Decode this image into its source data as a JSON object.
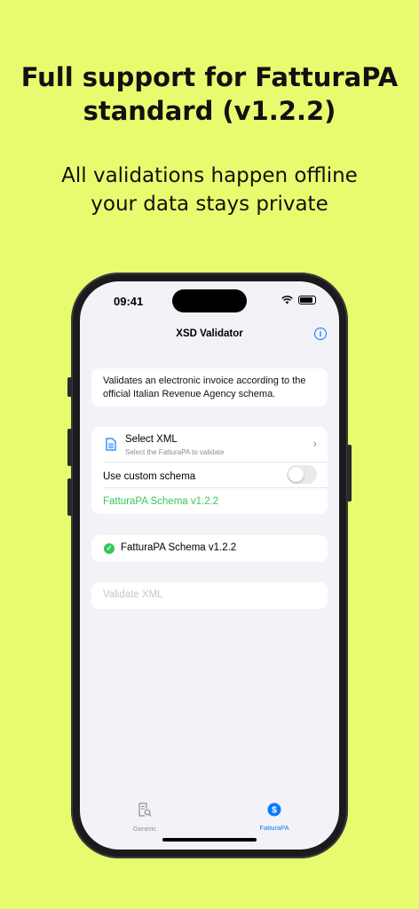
{
  "headline": {
    "line1": "Full support for FatturaPA",
    "line2": "standard (v1.2.2)"
  },
  "subline": {
    "line1": "All validations happen offline",
    "line2": "your data stays private"
  },
  "status_bar": {
    "time": "09:41"
  },
  "nav": {
    "title": "XSD Validator",
    "info_icon": "i"
  },
  "description": "Validates an electronic invoice according to the official Italian Revenue Agency schema.",
  "select_xml": {
    "title": "Select XML",
    "subtitle": "Select the FatturaPA to validate"
  },
  "custom_schema": {
    "label": "Use custom schema",
    "enabled": false
  },
  "schema_link": "FatturaPA Schema v1.2.2",
  "status": {
    "text": "FatturaPA Schema v1.2.2",
    "state": "valid"
  },
  "validate_button": "Validate XML",
  "tabs": [
    {
      "label": "Generic",
      "icon": "doc-search-icon",
      "selected": false
    },
    {
      "label": "FatturaPA",
      "icon": "dollar-circle-icon",
      "selected": true
    }
  ],
  "colors": {
    "background": "#e8fb6e",
    "accent": "#0a7aff",
    "success": "#34c759"
  }
}
